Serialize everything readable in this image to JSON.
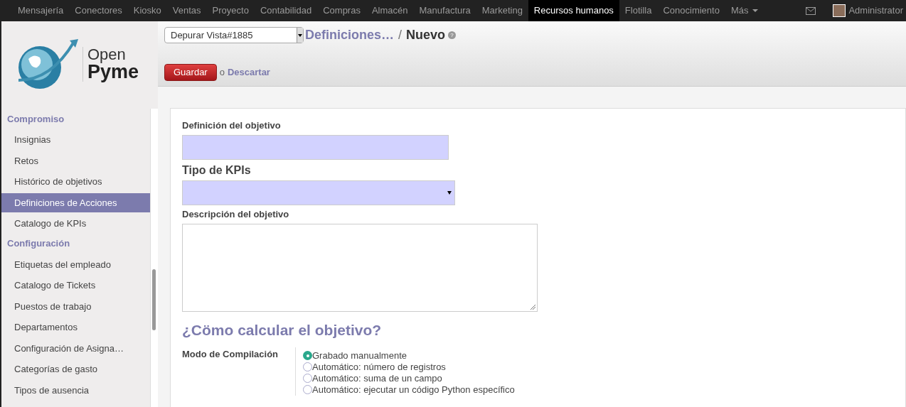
{
  "top_menu": [
    {
      "label": "Mensajería",
      "selected": false
    },
    {
      "label": "Conectores",
      "selected": false
    },
    {
      "label": "Kiosko",
      "selected": false
    },
    {
      "label": "Ventas",
      "selected": false
    },
    {
      "label": "Proyecto",
      "selected": false
    },
    {
      "label": "Contabilidad",
      "selected": false
    },
    {
      "label": "Compras",
      "selected": false
    },
    {
      "label": "Almacén",
      "selected": false
    },
    {
      "label": "Manufactura",
      "selected": false
    },
    {
      "label": "Marketing",
      "selected": false
    },
    {
      "label": "Recursos humanos",
      "selected": true
    },
    {
      "label": "Flotilla",
      "selected": false
    },
    {
      "label": "Conocimiento",
      "selected": false
    },
    {
      "label": "Más",
      "selected": false
    }
  ],
  "user": {
    "name": "Administrator"
  },
  "logo": {
    "line_1": "Open",
    "line_2": "Pyme"
  },
  "sidebar": {
    "sections": [
      {
        "title": "Compromiso",
        "items": [
          {
            "label": "Insignias",
            "selected": false
          },
          {
            "label": "Retos",
            "selected": false
          },
          {
            "label": "Histórico de objetivos",
            "selected": false
          },
          {
            "label": "Definiciones de Acciones",
            "selected": true
          },
          {
            "label": "Catalogo de KPIs",
            "selected": false
          }
        ]
      },
      {
        "title": "Configuración",
        "items": [
          {
            "label": "Etiquetas del empleado",
            "selected": false
          },
          {
            "label": "Catalogo de Tickets",
            "selected": false
          },
          {
            "label": "Puestos de trabajo",
            "selected": false
          },
          {
            "label": "Departamentos",
            "selected": false
          },
          {
            "label": "Configuración de Asigna…",
            "selected": false
          },
          {
            "label": "Categorías de gasto",
            "selected": false
          },
          {
            "label": "Tipos de ausencia",
            "selected": false
          }
        ]
      }
    ]
  },
  "debug_select": {
    "value": "Depurar Vista#1885"
  },
  "breadcrumb": {
    "parent": "Definiciones…",
    "separator": "/",
    "current": "Nuevo",
    "help": "?"
  },
  "actions": {
    "save": "Guardar",
    "or": "o",
    "discard": "Descartar"
  },
  "form": {
    "goal_label": "Definición del objetivo",
    "kpi_label": "Tipo de KPIs",
    "description_label": "Descripción del objetivo",
    "section_title": "¿Cömo calcular el objetivo?",
    "mode_label": "Modo de Compilación",
    "modes": [
      {
        "label": "Grabado manualmente",
        "selected": true
      },
      {
        "label": "Automático: número de registros",
        "selected": false
      },
      {
        "label": "Automático: suma de un campo",
        "selected": false
      },
      {
        "label": "Automático: ejecutar un código Python específico",
        "selected": false
      }
    ]
  }
}
